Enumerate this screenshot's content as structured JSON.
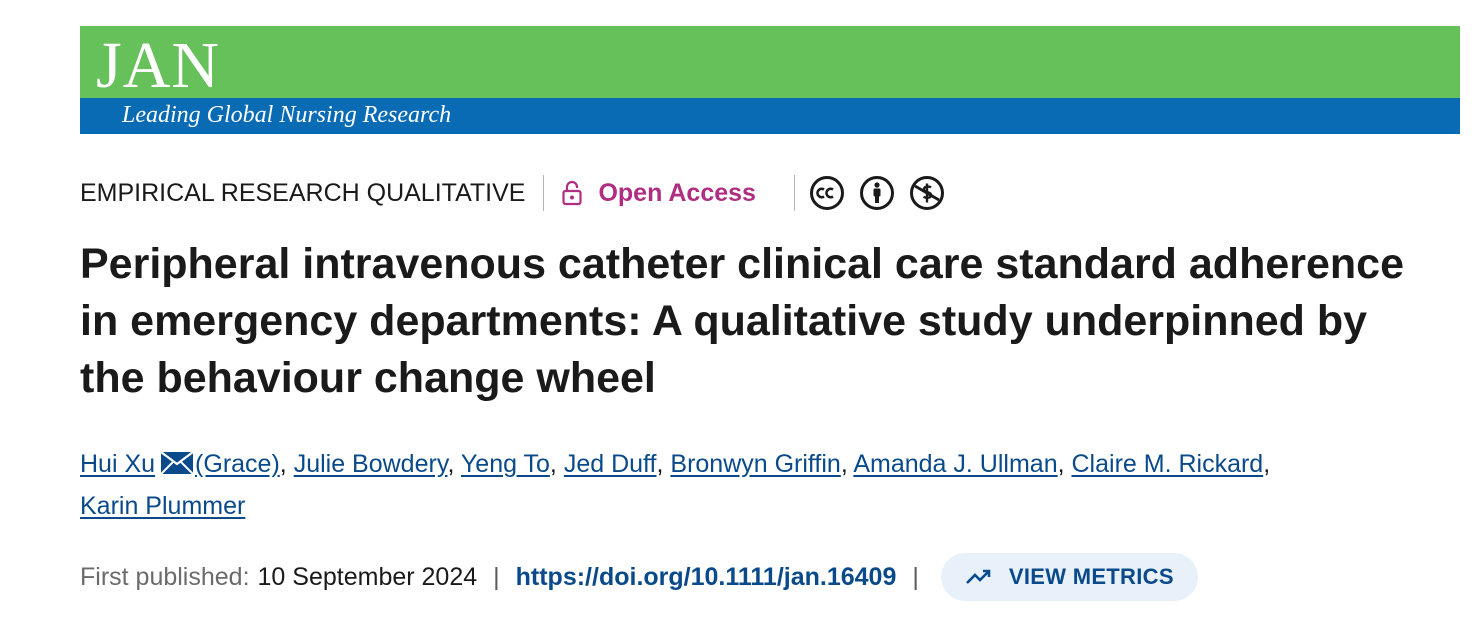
{
  "journal": {
    "logo_text": "JAN",
    "tagline": "Leading Global Nursing Research"
  },
  "meta": {
    "article_type": "EMPIRICAL RESEARCH QUALITATIVE",
    "access_label": "Open Access",
    "license_icons": [
      "cc-icon",
      "by-attribution-icon",
      "non-commercial-icon"
    ]
  },
  "article": {
    "title": "Peripheral intravenous catheter clinical care standard adherence in emergency departments: A qualitative study underpinned by the behaviour change wheel"
  },
  "authors": {
    "names": [
      "Hui Xu",
      "(Grace)",
      "Julie Bowdery",
      "Yeng To",
      "Jed Duff",
      "Bronwyn Griffin",
      "Amanda J. Ullman",
      "Claire M. Rickard",
      "Karin Plummer"
    ]
  },
  "publication": {
    "first_published_label": "First published:",
    "first_published_date": "10 September 2024",
    "doi": "https://doi.org/10.1111/jan.16409",
    "metrics_label": "VIEW METRICS"
  },
  "colors": {
    "banner_green": "#66c15a",
    "banner_blue": "#0a6bb5",
    "open_access": "#b02e81",
    "link": "#0a4a8a"
  }
}
